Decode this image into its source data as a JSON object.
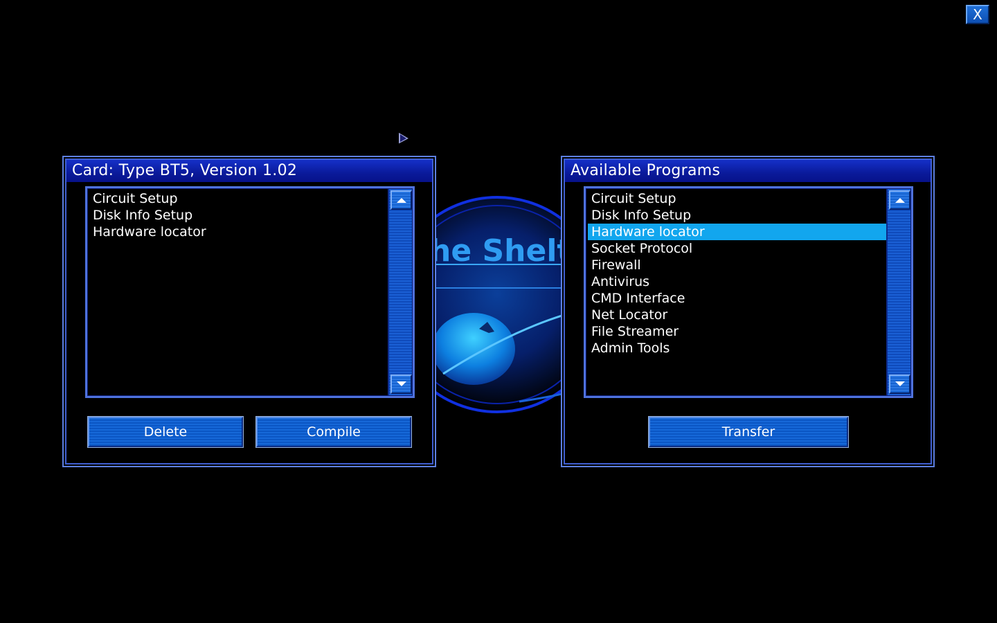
{
  "window": {
    "close_label": "X"
  },
  "background_logo": {
    "visible_text": "he Shelte"
  },
  "card_panel": {
    "title": "Card: Type BT5, Version 1.02",
    "items": [
      {
        "label": "Circuit Setup"
      },
      {
        "label": "Disk Info Setup"
      },
      {
        "label": "Hardware locator"
      }
    ],
    "delete_label": "Delete",
    "compile_label": "Compile"
  },
  "programs_panel": {
    "title": "Available Programs",
    "items": [
      {
        "label": "Circuit Setup"
      },
      {
        "label": "Disk Info Setup"
      },
      {
        "label": "Hardware locator",
        "selected": true
      },
      {
        "label": "Socket Protocol"
      },
      {
        "label": "Firewall"
      },
      {
        "label": "Antivirus"
      },
      {
        "label": "CMD Interface"
      },
      {
        "label": "Net Locator"
      },
      {
        "label": "File Streamer"
      },
      {
        "label": "Admin Tools"
      }
    ],
    "transfer_label": "Transfer"
  },
  "colors": {
    "panel_border": "#5d7fe0",
    "title_bar": "#0a1a9a",
    "selection": "#12a6ee",
    "button": "#1668d8"
  }
}
